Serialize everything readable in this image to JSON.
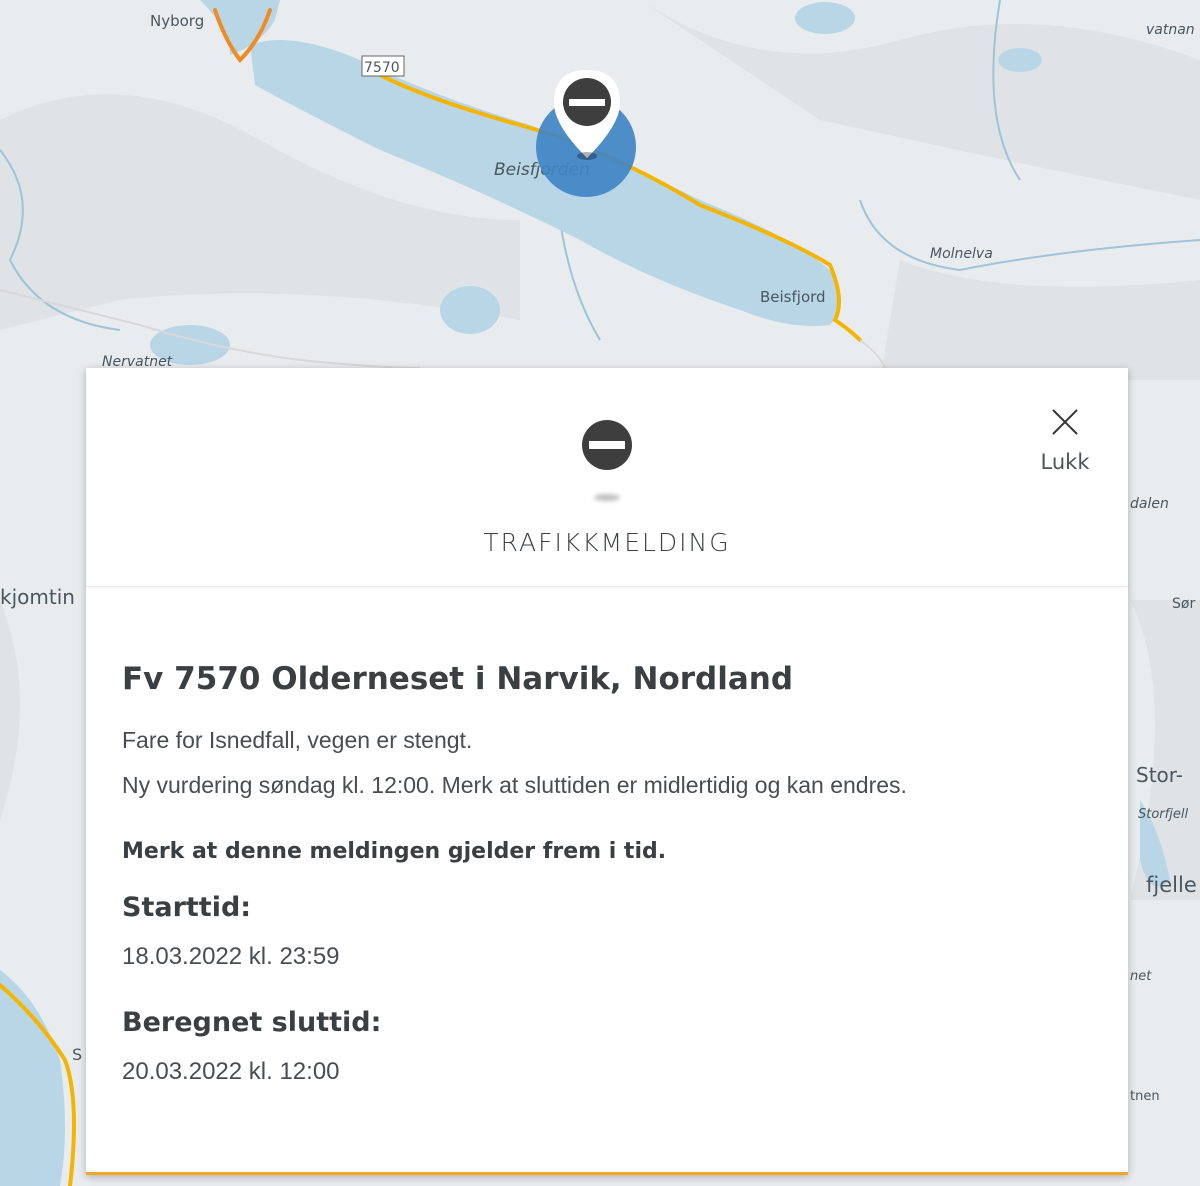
{
  "map": {
    "labels": {
      "nyborg": "Nyborg",
      "road_7570": "7570",
      "beisfjorden": "Beisfjorden",
      "beisfjord": "Beisfjord",
      "molnelva": "Molnelva",
      "nervatnet": "Nervatnet",
      "vatnan": "vatnan",
      "kjomtin": "kjomtin",
      "dalen": "dalen",
      "sor": "Sør",
      "stor": "Stor-",
      "storfjell": "Storfjell",
      "fjelle": "fjelle",
      "net": "net",
      "tnen": "tnen",
      "s": "S"
    },
    "marker_icon": "no-entry-icon",
    "colors": {
      "water": "#b9d6e6",
      "road": "#f4b400",
      "terrain": "#e9ecee",
      "marker_halo": "#3f86c6"
    }
  },
  "panel": {
    "category": "TRAFIKKMELDING",
    "category_icon": "no-entry-icon",
    "close_label": "Lukk",
    "close_icon": "close-icon",
    "title": "Fv 7570 Olderneset i Narvik, Nordland",
    "description_1": "Fare for Isnedfall, vegen er stengt.",
    "description_2": "Ny vurdering søndag kl. 12:00. Merk at sluttiden er midlertidig og kan endres.",
    "notice": "Merk at denne meldingen gjelder frem i tid.",
    "start_label": "Starttid:",
    "start_value": "18.03.2022 kl. 23:59",
    "end_label": "Beregnet sluttid:",
    "end_value": "20.03.2022 kl. 12:00",
    "accent_color": "#f5a623"
  }
}
